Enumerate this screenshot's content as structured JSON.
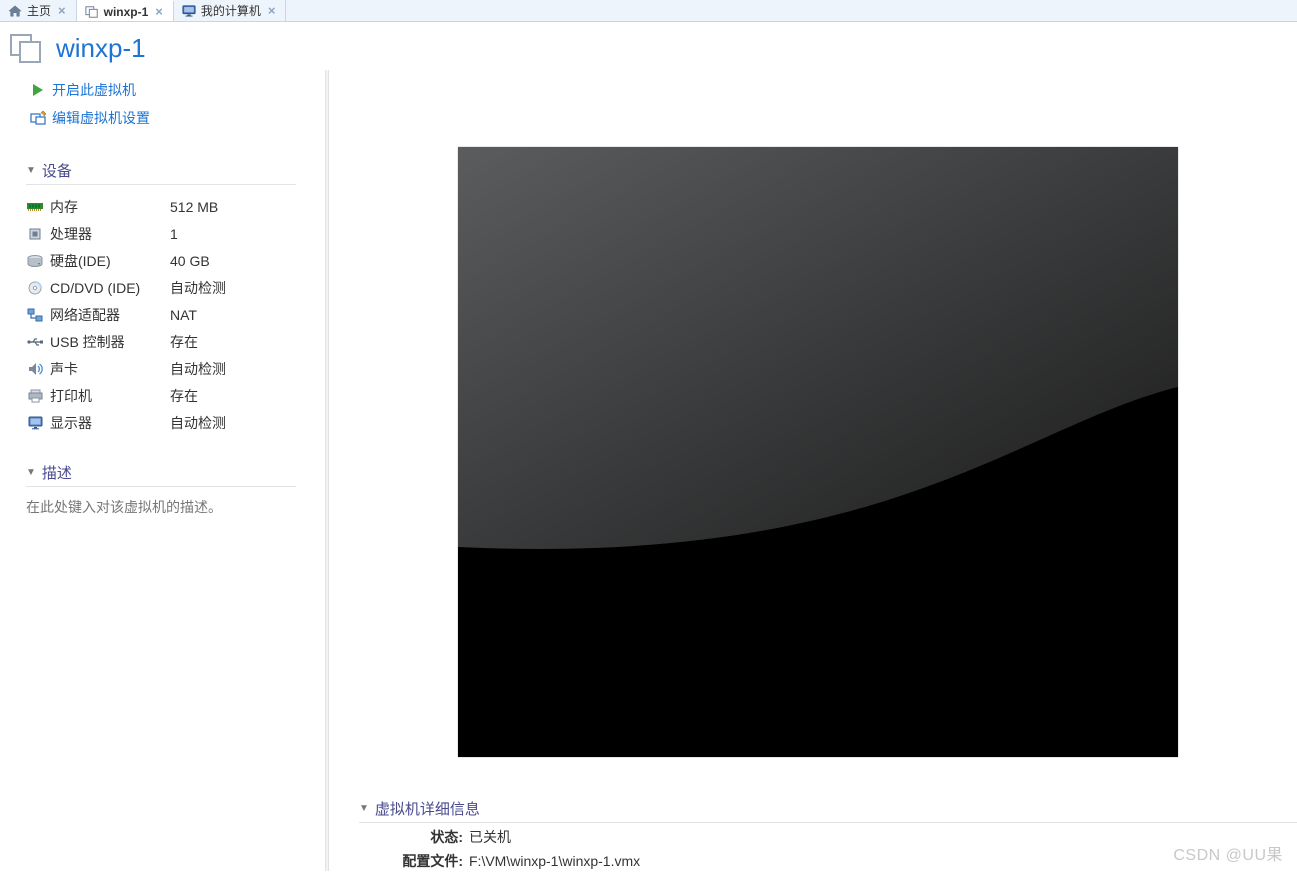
{
  "tabs": [
    {
      "label": "主页",
      "icon": "home-icon",
      "active": false
    },
    {
      "label": "winxp-1",
      "icon": "vm-icon",
      "active": true
    },
    {
      "label": "我的计算机",
      "icon": "monitor-icon",
      "active": false
    }
  ],
  "vm": {
    "title": "winxp-1"
  },
  "actions": {
    "power_on": "开启此虚拟机",
    "edit_settings": "编辑虚拟机设置"
  },
  "sections": {
    "devices": "设备",
    "description": "描述",
    "details": "虚拟机详细信息"
  },
  "devices": [
    {
      "icon": "memory-icon",
      "name": "内存",
      "value": "512 MB"
    },
    {
      "icon": "cpu-icon",
      "name": "处理器",
      "value": "1"
    },
    {
      "icon": "disk-icon",
      "name": "硬盘(IDE)",
      "value": "40 GB"
    },
    {
      "icon": "cd-icon",
      "name": "CD/DVD (IDE)",
      "value": "自动检测"
    },
    {
      "icon": "network-icon",
      "name": "网络适配器",
      "value": "NAT"
    },
    {
      "icon": "usb-icon",
      "name": "USB 控制器",
      "value": "存在"
    },
    {
      "icon": "sound-icon",
      "name": "声卡",
      "value": "自动检测"
    },
    {
      "icon": "printer-icon",
      "name": "打印机",
      "value": "存在"
    },
    {
      "icon": "display-icon",
      "name": "显示器",
      "value": "自动检测"
    }
  ],
  "description_placeholder": "在此处键入对该虚拟机的描述。",
  "details": {
    "state_label": "状态:",
    "state_value": "已关机",
    "config_label": "配置文件:",
    "config_value": "F:\\VM\\winxp-1\\winxp-1.vmx"
  },
  "watermark": "CSDN @UU果"
}
